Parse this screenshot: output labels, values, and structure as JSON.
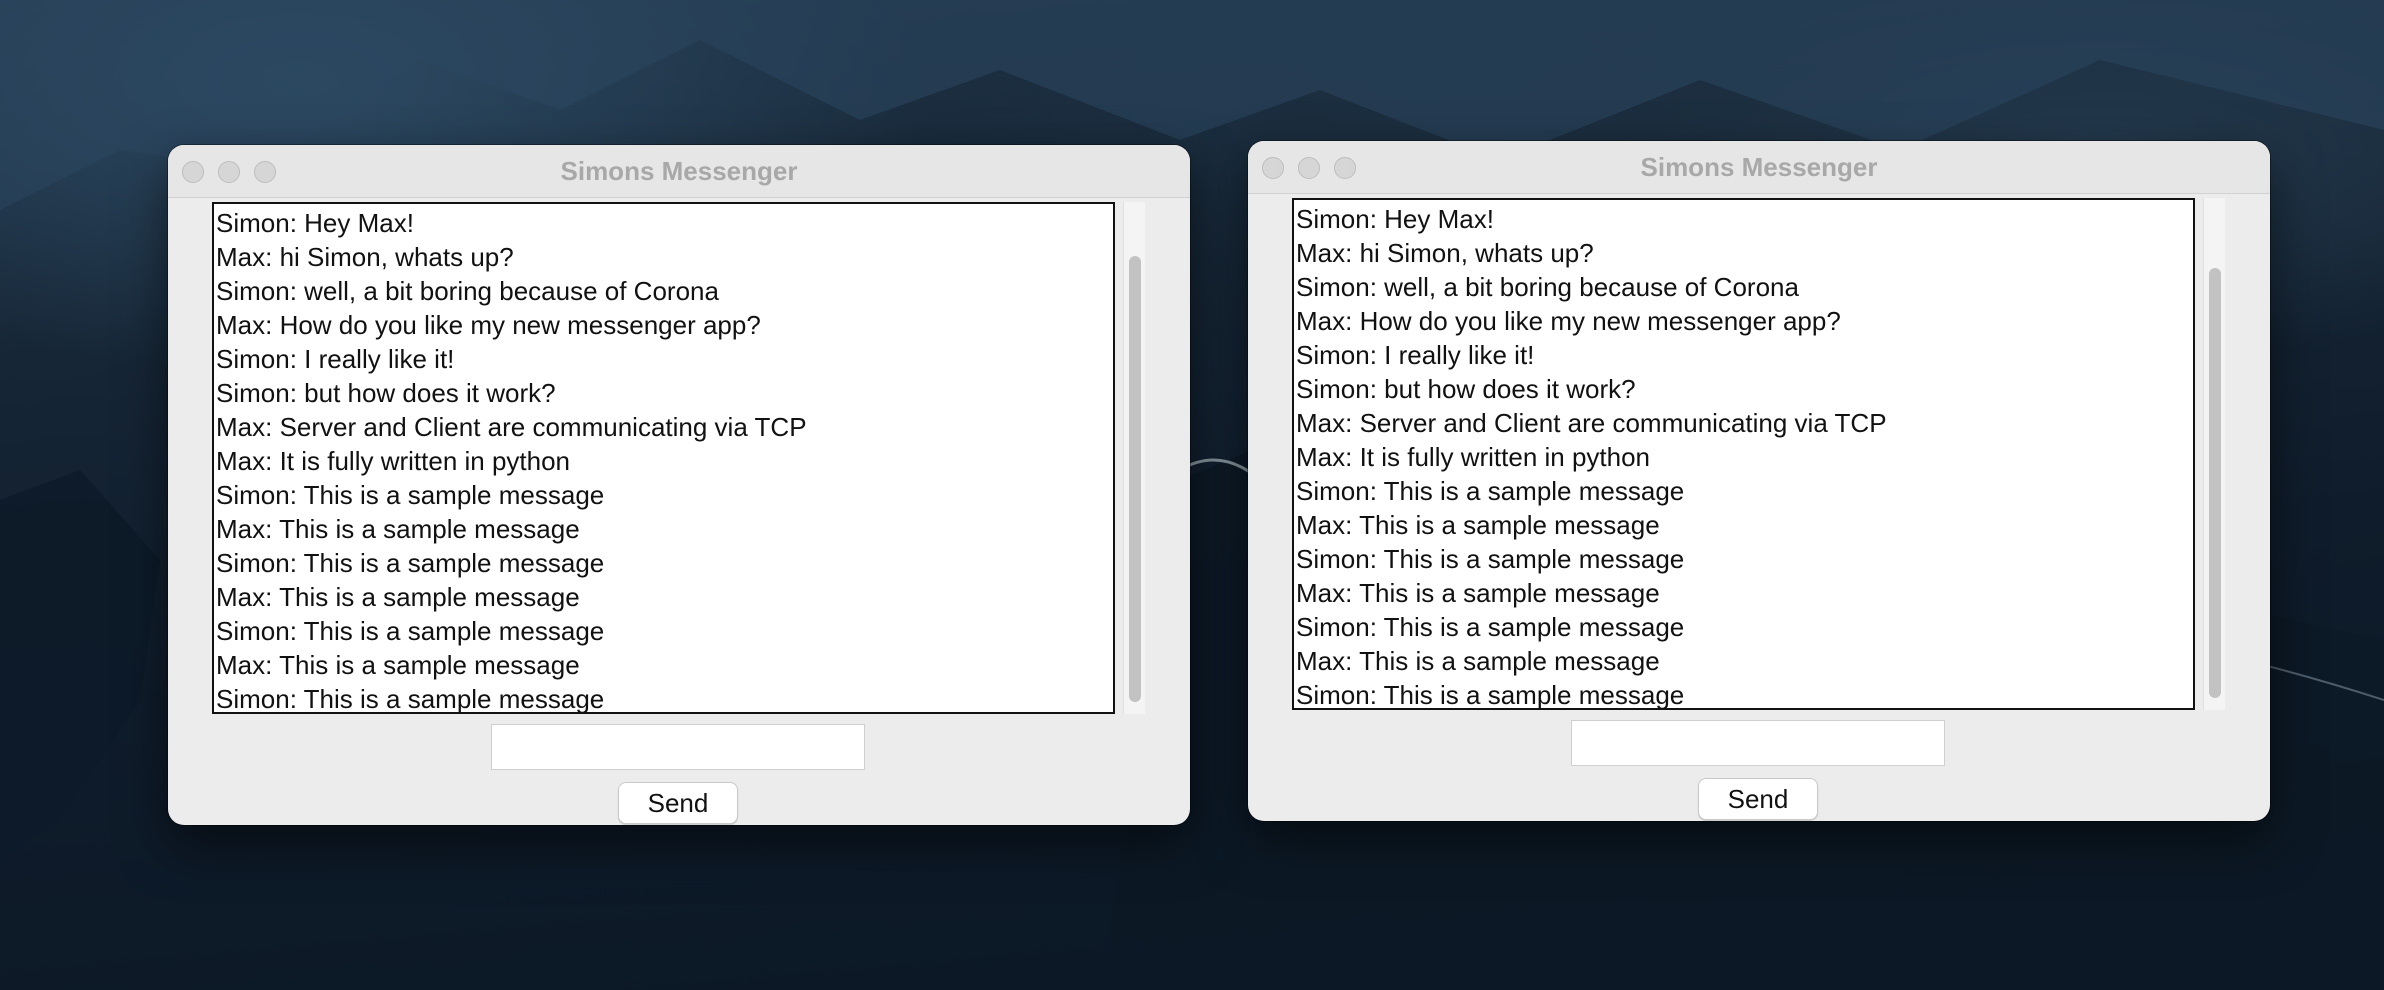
{
  "windows": [
    {
      "title": "Simons Messenger",
      "messages": [
        "Simon: Hey Max!",
        "Max: hi Simon, whats up?",
        "Simon: well, a bit boring because of Corona",
        "Max: How do you like my new messenger app?",
        "Simon: I really like it!",
        "Simon: but how does it work?",
        "Max: Server and Client are communicating via TCP",
        "Max: It is fully written in python",
        "Simon: This is a sample message",
        "Max: This is a sample message",
        "Simon: This is a sample message",
        "Max: This is a sample message",
        "Simon: This is a sample message",
        "Max: This is a sample message",
        "Simon: This is a sample message"
      ],
      "input_value": "",
      "send_label": "Send"
    },
    {
      "title": "Simons Messenger",
      "messages": [
        "Simon: Hey Max!",
        "Max: hi Simon, whats up?",
        "Simon: well, a bit boring because of Corona",
        "Max: How do you like my new messenger app?",
        "Simon: I really like it!",
        "Simon: but how does it work?",
        "Max: Server and Client are communicating via TCP",
        "Max: It is fully written in python",
        "Simon: This is a sample message",
        "Max: This is a sample message",
        "Simon: This is a sample message",
        "Max: This is a sample message",
        "Simon: This is a sample message",
        "Max: This is a sample message",
        "Simon: This is a sample message"
      ],
      "input_value": "",
      "send_label": "Send"
    }
  ]
}
